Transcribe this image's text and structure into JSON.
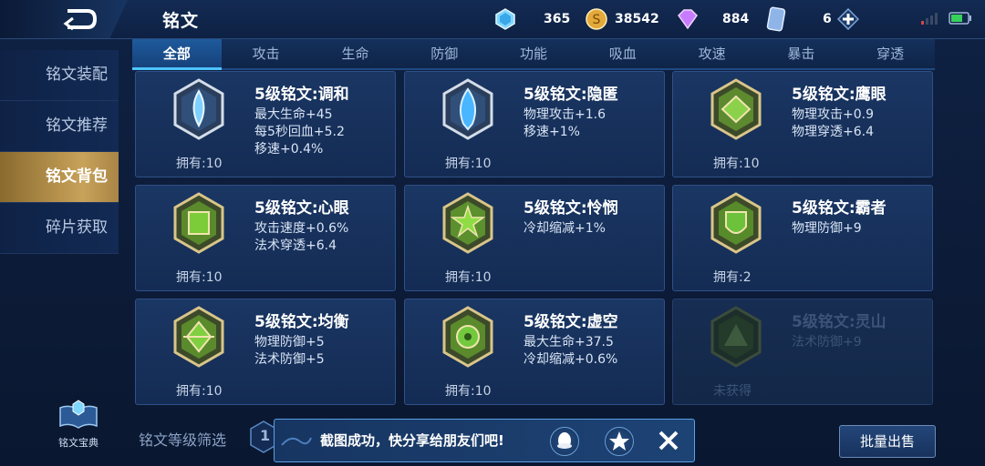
{
  "header": {
    "title": "铭文",
    "back_icon": "back-arrow-icon"
  },
  "resources": [
    {
      "name": "crystal",
      "icon": "crystal-icon",
      "value": "365"
    },
    {
      "name": "gold",
      "icon": "gold-coin-icon",
      "value": "38542"
    },
    {
      "name": "diamond",
      "icon": "diamond-icon",
      "value": "884"
    },
    {
      "name": "card",
      "icon": "card-icon",
      "value": "6"
    }
  ],
  "tabs": [
    "全部",
    "攻击",
    "生命",
    "防御",
    "功能",
    "吸血",
    "攻速",
    "暴击",
    "穿透"
  ],
  "sidebar": [
    "铭文装配",
    "铭文推荐",
    "铭文背包",
    "碎片获取"
  ],
  "cards": [
    {
      "name": "5级铭文:调和",
      "attrs": [
        "最大生命+45",
        "每5秒回血+5.2",
        "移速+0.4%"
      ],
      "owned": "拥有:10",
      "color": "#c9d6e6",
      "gem": "#7fd0ff"
    },
    {
      "name": "5级铭文:隐匿",
      "attrs": [
        "物理攻击+1.6",
        "移速+1%"
      ],
      "owned": "拥有:10",
      "color": "#c9d6e6",
      "gem": "#49b6ff"
    },
    {
      "name": "5级铭文:鹰眼",
      "attrs": [
        "物理攻击+0.9",
        "物理穿透+6.4"
      ],
      "owned": "拥有:10",
      "color": "#d9c58a",
      "gem": "#8bd24a"
    },
    {
      "name": "5级铭文:心眼",
      "attrs": [
        "攻击速度+0.6%",
        "法术穿透+6.4"
      ],
      "owned": "拥有:10",
      "color": "#d9c58a",
      "gem": "#7ccc3a"
    },
    {
      "name": "5级铭文:怜悯",
      "attrs": [
        "冷却缩减+1%"
      ],
      "owned": "拥有:10",
      "color": "#d9c58a",
      "gem": "#8fdc44"
    },
    {
      "name": "5级铭文:霸者",
      "attrs": [
        "物理防御+9"
      ],
      "owned": "拥有:2",
      "color": "#d9c58a",
      "gem": "#6cc23a"
    },
    {
      "name": "5级铭文:均衡",
      "attrs": [
        "物理防御+5",
        "法术防御+5"
      ],
      "owned": "拥有:10",
      "color": "#d9c58a",
      "gem": "#7fcf40"
    },
    {
      "name": "5级铭文:虚空",
      "attrs": [
        "最大生命+37.5",
        "冷却缩减+0.6%"
      ],
      "owned": "拥有:10",
      "color": "#d9c58a",
      "gem": "#73c93e"
    },
    {
      "name": "5级铭文:灵山",
      "attrs": [
        "法术防御+9"
      ],
      "owned": "未获得",
      "color": "#4a5a4a",
      "gem": "#3e5a3e",
      "dim": true
    }
  ],
  "bottom": {
    "codex_label": "铭文宝典",
    "filter_label": "铭文等级筛选",
    "filter_value": "1",
    "toast": "截图成功，快分享给朋友们吧!",
    "batch_button": "批量出售"
  },
  "colors": {
    "accent": "#4fc3ff",
    "active_side": "#c8a25a",
    "card_bg": "#1a3663"
  }
}
